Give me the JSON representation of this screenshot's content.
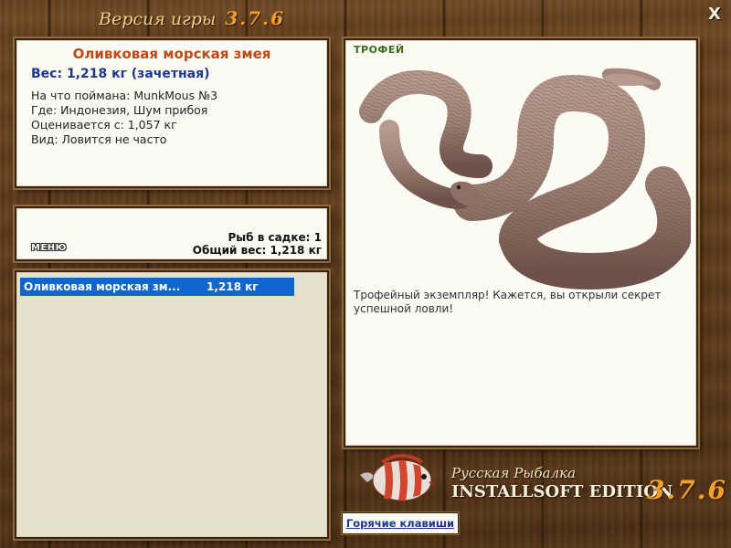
{
  "window": {
    "title": "Версия игры",
    "version": "3.7.6",
    "close_label": "X"
  },
  "info": {
    "fish_name": "Оливковая морская змея",
    "weight": "Вес: 1,218 кг (зачетная)",
    "caught_on": "На что поймана: MunkMous №3",
    "where": "Где: Индонезия, Шум прибоя",
    "rated_from": "Оценивается с: 1,057 кг",
    "kind": "Вид: Ловится не часто"
  },
  "stats": {
    "fish_count": "Рыб в садке: 1",
    "total_weight": "Общий вес: 1,218 кг"
  },
  "menu_button": "МЕНЮ",
  "catch_list": [
    {
      "name": "Оливковая морская зм...",
      "weight": "1,218 кг"
    }
  ],
  "trophy": {
    "label": "ТРОФЕЙ",
    "description": "Трофейный экземпляр! Кажется, вы открыли секрет успешной ловли!"
  },
  "brand": {
    "name_ru": "Русская Рыбалка",
    "edition": "INSTALLSOFT EDITION",
    "version": "3.7.6"
  },
  "hotkeys_button": "Горячие клавиши",
  "colors": {
    "fish_name": "#c0491a",
    "weight": "#1c3692",
    "selection": "#0f66cf",
    "trophy_label": "#3e6b1b",
    "version_accent": "#f2a12a"
  },
  "icons": [
    "close-icon",
    "snake-photo",
    "brand-fish-logo"
  ]
}
